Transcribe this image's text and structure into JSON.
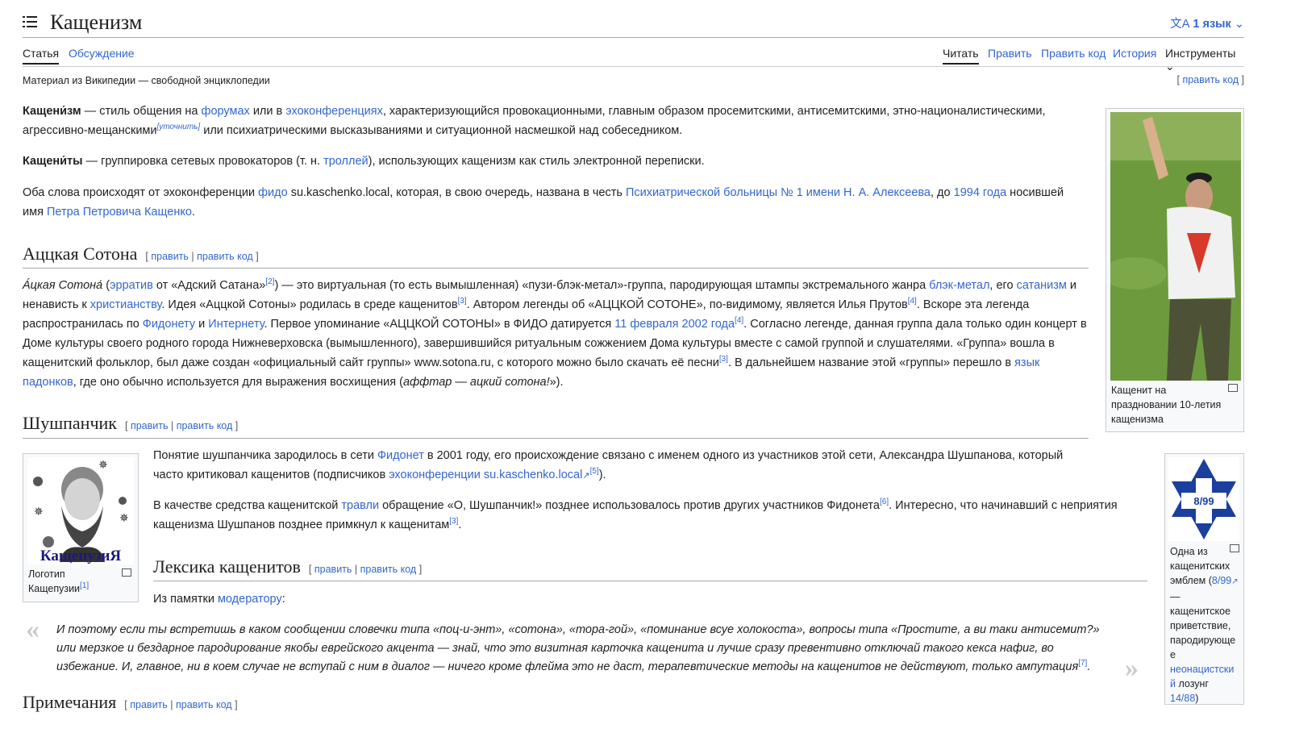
{
  "header": {
    "title": "Кащенизм",
    "language_button": "1 язык",
    "tabs_left": [
      "Статья",
      "Обсуждение"
    ],
    "tabs_right": [
      "Читать",
      "Править",
      "Править код",
      "История",
      "Инструменты"
    ]
  },
  "tagline": "Материал из Википедии — свободной энциклопедии",
  "edit_top": "править код",
  "intro": {
    "p1_term": "Кащени́зм",
    "p1_a": " — стиль общения на ",
    "p1_link1": "форумах",
    "p1_b": " или в ",
    "p1_link2": "эхоконференциях",
    "p1_c": ", характеризующийся провокационными, главным образом просемитскими, антисемитскими, этно-националистическими, агрессивно-мещанскими",
    "p1_note": "[уточнить]",
    "p1_d": " или психиатрическими высказываниями и ситуационной насмешкой над собеседником.",
    "p2_term": "Кащени́ты",
    "p2_a": " — группировка сетевых провокаторов (т. н. ",
    "p2_link": "троллей",
    "p2_b": "), использующих кащенизм как стиль электронной переписки.",
    "p3_a": "Оба слова происходят от эхоконференции ",
    "p3_link1": "фидо",
    "p3_b": " su.kaschenko.local, которая, в свою очередь, названа в честь ",
    "p3_link2": "Психиатрической больницы № 1 имени Н. А. Алексеева",
    "p3_c": ", до ",
    "p3_link3": "1994 года",
    "p3_d": " носившей имя ",
    "p3_link4": "Петра Петровича Кащенко",
    "p3_e": "."
  },
  "section_edit": {
    "edit": "править",
    "edit_code": "править код"
  },
  "sotona": {
    "heading": "Аццкая Сотона",
    "t1": "А́цкая Сотона́",
    "t2": " (",
    "l1": "эрратив",
    "t3": " от «Адский Сатана»",
    "r2": "[2]",
    "t4": ") — это виртуальная (то есть вымышленная) «пузи-блэк-метал»-группа, пародирующая штампы экстремального жанра ",
    "l2": "блэк-метал",
    "t5": ", его ",
    "l3": "сатанизм",
    "t6": " и ненависть к ",
    "l4": "христианству",
    "t7": ". Идея «Аццкой Сотоны» родилась в среде кащенитов",
    "r3": "[3]",
    "t8": ". Автором легенды об «АЦЦКОЙ СОТОНЕ», по-видимому, является Илья Прутов",
    "r4": "[4]",
    "t9": ". Вскоре эта легенда распространилась по ",
    "l5": "Фидонету",
    "t10": " и ",
    "l6": "Интернету",
    "t11": ". Первое упоминание «АЦЦКОЙ СОТОНЫ» в ФИДО датируется ",
    "l7": "11 февраля 2002 года",
    "r4b": "[4]",
    "t12": ". Согласно легенде, данная группа дала только один концерт в Доме культуры своего родного города Нижневерховска (вымышленного), завершившийся ритуальным сожжением Дома культуры вместе с самой группой и слушателями. «Группа» вошла в кащенитский фольклор, был даже создан «официальный сайт группы» www.sotona.ru, с которого можно было скачать её песни",
    "r3b": "[3]",
    "t13": ". В дальнейшем название этой «группы» перешло в ",
    "l8": "язык падонков",
    "t14": ", где оно обычно используется для выражения восхищения (",
    "em": "аффтар — ацкий сотона!",
    "t15": "»)."
  },
  "shushpanchik": {
    "heading": "Шушпанчик",
    "p1a": "Понятие шушпанчика зародилось в сети ",
    "p1l1": "Фидонет",
    "p1b": " в 2001 году, его происхождение связано с именем одного из участников этой сети, Александра Шушпанова, который часто критиковал кащенитов (подписчиков ",
    "p1l2": "эхоконференции su.kaschenko.local",
    "p1r": "[5]",
    "p1c": ").",
    "p2a": "В качестве средства кащенитской ",
    "p2l": "травли",
    "p2b": " обращение «О, Шушпанчик!» позднее использовалось против других участников Фидонета",
    "p2r": "[6]",
    "p2c": ". Интересно, что начинавший с неприятия кащенизма Шушпанов позднее примкнул к кащенитам",
    "p2r2": "[3]",
    "p2d": "."
  },
  "lexicon": {
    "heading": "Лексика кащенитов",
    "from_a": "Из памятки ",
    "from_link": "модератору",
    "from_b": ":",
    "quote": "И поэтому если ты встретишь в каком сообщении словечки типа «поц-и-энт», «сотона», «тора-гой», «поминание всуе холокоста», вопросы типа «Простите, а ви таки антисемит?» или мерзкое и бездарное пародирование якобы еврейского акцента — знай, что это визитная карточка кащенита и лучше сразу превентивно отключай такого кекса нафиг, во избежание. И, главное, ни в коем случае не вступай с ним в диалог — ничего кроме флейма это не даст, терапевтические методы на кащенитов не действуют, только ампутация",
    "quote_ref": "[7]",
    "quote_end": "."
  },
  "notes_heading": "Примечания",
  "figures": {
    "photo_caption": "Кащенит на праздновании 10-летия кащенизма",
    "logo_text": "КащепузиЯ",
    "logo_caption_a": "Логотип Кащепузии",
    "logo_caption_ref": "[1]",
    "emblem_text": "8/99",
    "emblem_caption_a": "Одна из кащенитских эмблем (",
    "emblem_link": "8/99",
    "emblem_caption_b": " — кащенитское приветствие, пародирующее ",
    "emblem_link2": "неонацистский",
    "emblem_caption_c": " лозунг ",
    "emblem_link3": "14/88",
    "emblem_caption_d": ")"
  },
  "colors": {
    "link": "#3366cc",
    "text": "#202122",
    "border": "#a2a9b1",
    "emblem_blue": "#1a3f9c"
  }
}
